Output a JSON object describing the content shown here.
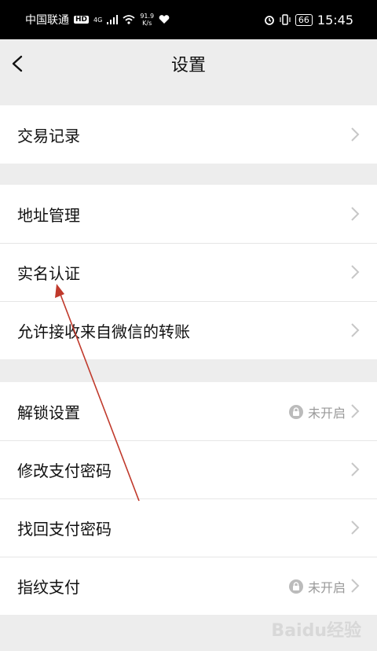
{
  "status_bar": {
    "carrier": "中国联通",
    "hd_badge": "HD",
    "network": "4G",
    "speed_value": "91.9",
    "speed_unit": "K/s",
    "battery": "66",
    "time": "15:45"
  },
  "header": {
    "title": "设置"
  },
  "groups": [
    {
      "items": [
        {
          "label": "交易记录"
        }
      ]
    },
    {
      "items": [
        {
          "label": "地址管理"
        },
        {
          "label": "实名认证"
        },
        {
          "label": "允许接收来自微信的转账"
        }
      ]
    },
    {
      "items": [
        {
          "label": "解锁设置",
          "status": "未开启"
        },
        {
          "label": "修改支付密码"
        },
        {
          "label": "找回支付密码"
        },
        {
          "label": "指纹支付",
          "status": "未开启"
        }
      ]
    }
  ],
  "watermark": "Baidu经验",
  "colors": {
    "background": "#ededed",
    "annotation_arrow": "#c0392b",
    "chevron": "#c7c7c7"
  }
}
